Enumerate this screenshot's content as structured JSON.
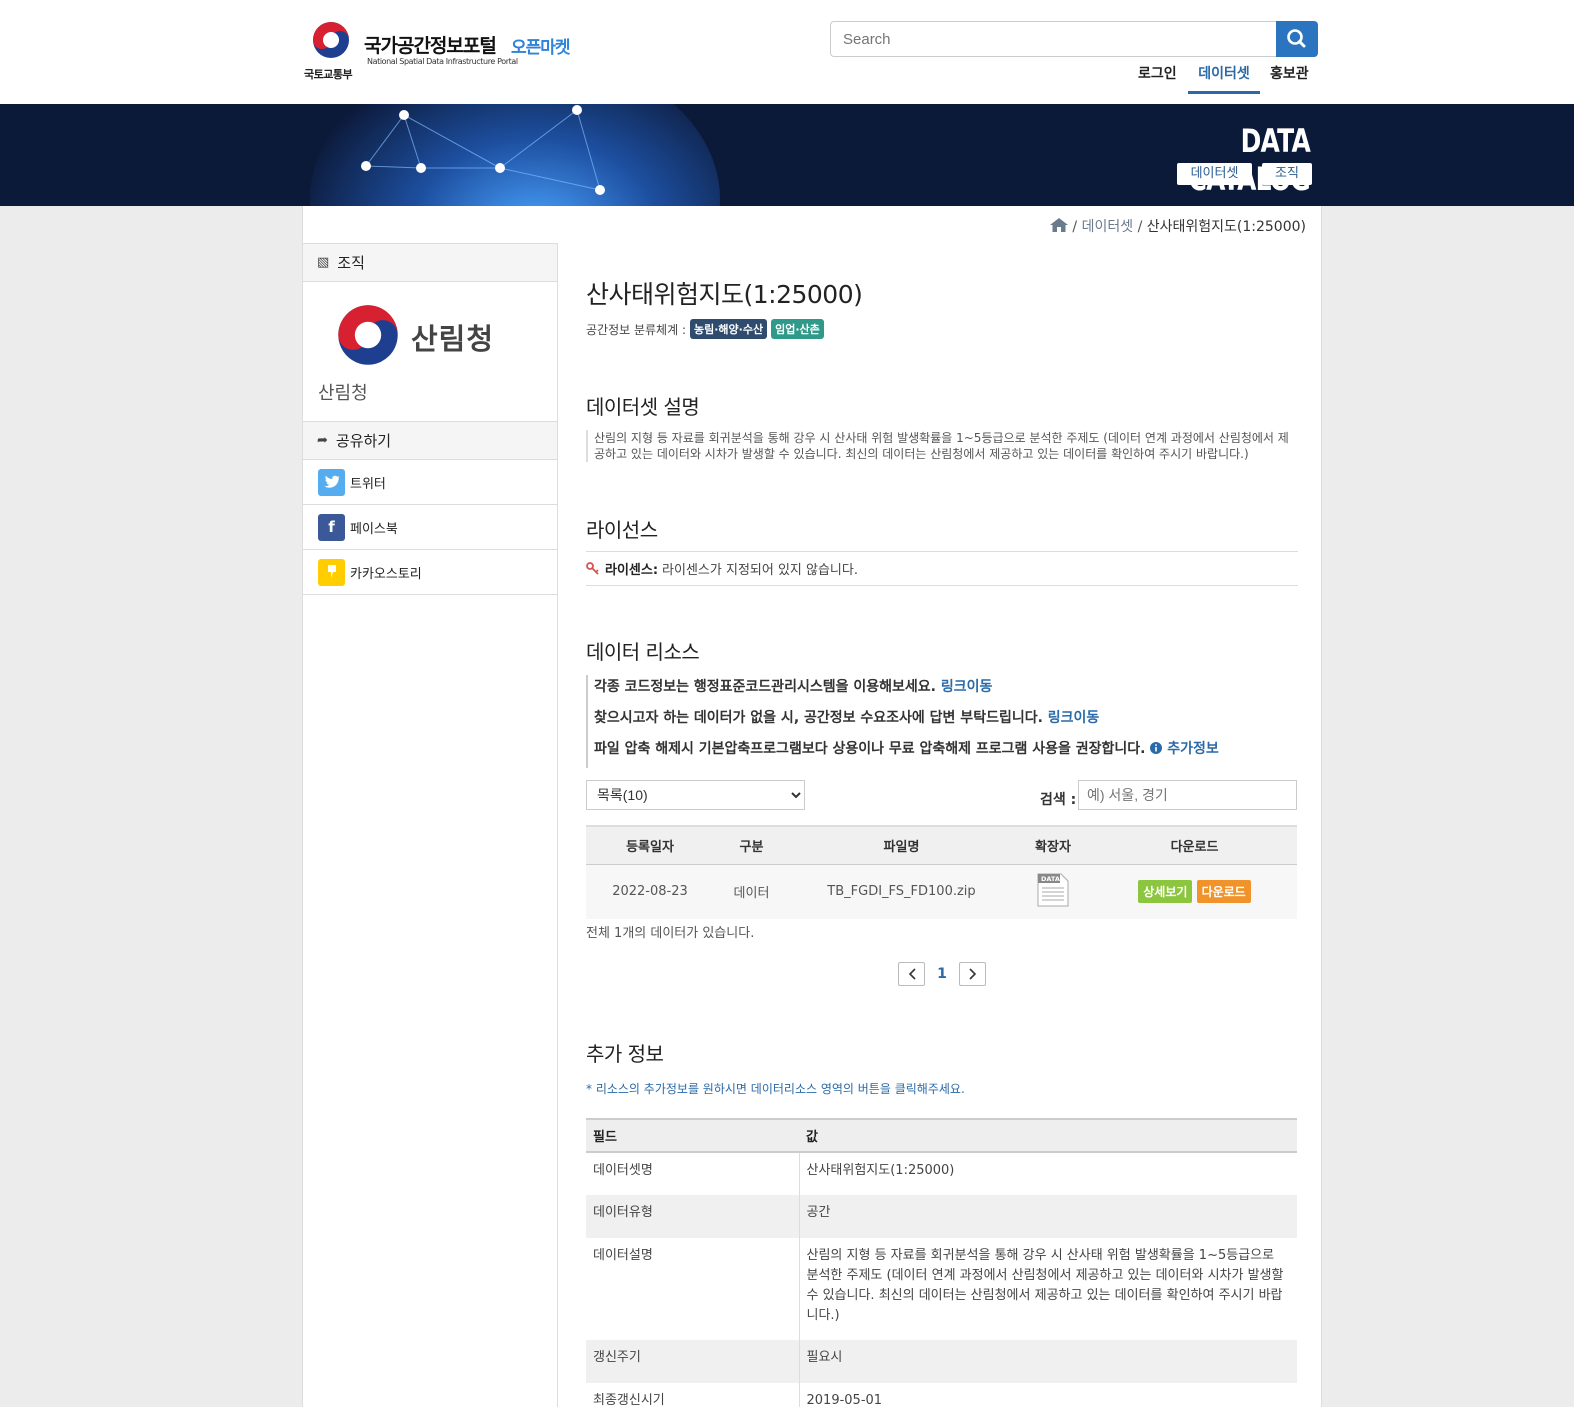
{
  "header": {
    "portal_title": "국가공간정보포털",
    "portal_market": "오픈마켓",
    "portal_sub": "National Spatial Data Infrastructure Portal",
    "ministry": "국토교통부",
    "search_placeholder": "Search",
    "nav": [
      {
        "label": "로그인",
        "active": false
      },
      {
        "label": "데이터셋",
        "active": true
      },
      {
        "label": "홍보관",
        "active": false
      }
    ]
  },
  "banner": {
    "title": "DATA CATALOG",
    "chips": [
      "데이터셋",
      "조직"
    ]
  },
  "breadcrumb": {
    "items": [
      "데이터셋",
      "산사태위험지도(1:25000)"
    ]
  },
  "sidebar": {
    "org_header": "조직",
    "org_logo_text": "산림청",
    "org_name": "산림청",
    "share_header": "공유하기",
    "share_items": [
      {
        "label": "트위터",
        "icon": "twitter-icon",
        "color": "#55acee"
      },
      {
        "label": "페이스북",
        "icon": "facebook-icon",
        "color": "#3b5998"
      },
      {
        "label": "카카오스토리",
        "icon": "kakaostory-icon",
        "color": "#ffcd00"
      }
    ]
  },
  "dataset": {
    "title": "산사태위험지도(1:25000)",
    "classification_label": "공간정보 분류체계 :",
    "tags": [
      {
        "label": "농림·해양·수산",
        "color": "#2f4b6e"
      },
      {
        "label": "임업·산촌",
        "color": "#2f9a8a"
      }
    ]
  },
  "description": {
    "heading": "데이터셋 설명",
    "text": "산림의 지형 등 자료를 회귀분석을 통해 강우 시 산사태 위험 발생확률을 1~5등급으로 분석한 주제도 (데이터 연계 과정에서 산림청에서 제공하고 있는 데이터와 시차가 발생할 수 있습니다. 최신의 데이터는 산림청에서 제공하고 있는 데이터를 확인하여 주시기 바랍니다.)"
  },
  "license": {
    "heading": "라이선스",
    "label": "라이센스:",
    "value": "라이센스가 지정되어 있지 않습니다."
  },
  "resources": {
    "heading": "데이터 리소스",
    "notes": [
      {
        "text": "각종 코드정보는 행정표준코드관리시스템을 이용해보세요.",
        "link": "링크이동"
      },
      {
        "text": "찾으시고자 하는 데이터가 없을 시, 공간정보 수요조사에 답변 부탁드립니다.",
        "link": "링크이동"
      },
      {
        "text": "파일 압축 해제시 기본압축프로그램보다 상용이나 무료 압축해제 프로그램 사용을 권장합니다.",
        "link": "추가정보"
      }
    ],
    "list_select": "목록(10)",
    "search_label": "검색 :",
    "search_placeholder": "예) 서울, 경기",
    "columns": [
      "등록일자",
      "구분",
      "파일명",
      "확장자",
      "다운로드"
    ],
    "rows": [
      {
        "date": "2022-08-23",
        "type": "데이터",
        "filename": "TB_FGDI_FS_FD100.zip",
        "ext_icon": "DATA",
        "detail_btn": "상세보기",
        "download_btn": "다운로드"
      }
    ],
    "total_text": "전체 1개의 데이터가 있습니다.",
    "current_page": "1"
  },
  "additional": {
    "heading": "추가 정보",
    "note": "* 리소스의 추가정보를 원하시면 데이터리소스 영역의 버튼을 클릭해주세요.",
    "columns": [
      "필드",
      "값"
    ],
    "rows": [
      {
        "field": "데이터셋명",
        "value": "산사태위험지도(1:25000)"
      },
      {
        "field": "데이터유형",
        "value": "공간"
      },
      {
        "field": "데이터설명",
        "value": "산림의 지형 등 자료를 회귀분석을 통해 강우 시 산사태 위험 발생확률을 1~5등급으로 분석한 주제도 (데이터 연계 과정에서 산림청에서 제공하고 있는 데이터와 시차가 발생할 수 있습니다. 최신의 데이터는 산림청에서 제공하고 있는 데이터를 확인하여 주시기 바랍니다.)"
      },
      {
        "field": "갱신주기",
        "value": "필요시"
      },
      {
        "field": "최종갱신시기",
        "value": "2019-05-01"
      }
    ]
  },
  "colors": {
    "primary": "#2a74c0",
    "banner_bg": "#0c1a3a",
    "detail_btn": "#8cc63f",
    "download_btn": "#f0932b"
  }
}
